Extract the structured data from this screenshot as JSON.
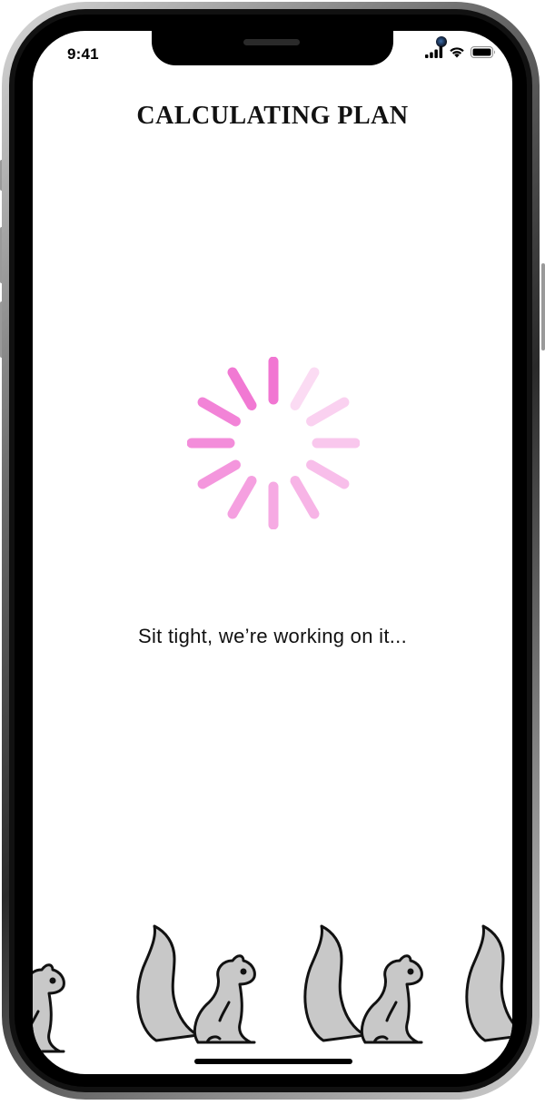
{
  "status_bar": {
    "time": "9:41",
    "icons": [
      "cellular-signal-icon",
      "wifi-icon",
      "battery-icon"
    ]
  },
  "screen": {
    "title": "CALCULATING PLAN",
    "message": "Sit tight, we’re working on it...",
    "spinner": {
      "color": "#f06fd0",
      "spoke_count": 12
    },
    "illustration": "squirrel-icon"
  },
  "device": {
    "frame_color": "#000000",
    "home_indicator": "home-indicator"
  }
}
